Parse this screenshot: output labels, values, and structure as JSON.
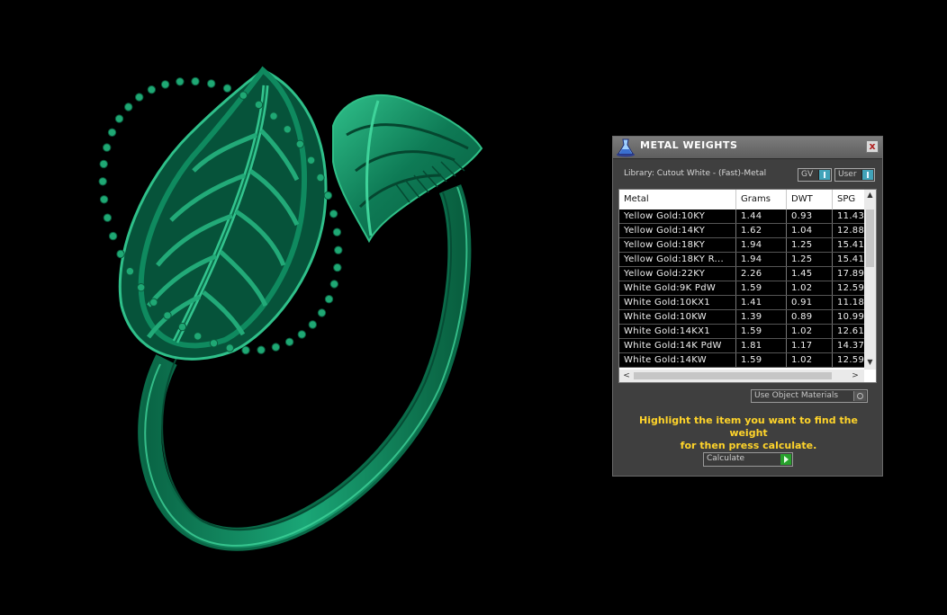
{
  "panel": {
    "title": "METAL WEIGHTS",
    "title_icon": "flask-icon",
    "close_label": "x",
    "library_label": "Library: Cutout White - (Fast)-Metal",
    "gv_label": "GV",
    "user_label": "User",
    "table": {
      "columns": [
        "Metal",
        "Grams",
        "DWT",
        "SPG"
      ],
      "rows": [
        [
          "Yellow Gold:10KY",
          "1.44",
          "0.93",
          "11.43"
        ],
        [
          "Yellow Gold:14KY",
          "1.62",
          "1.04",
          "12.88"
        ],
        [
          "Yellow Gold:18KY",
          "1.94",
          "1.25",
          "15.41"
        ],
        [
          "Yellow Gold:18KY R...",
          "1.94",
          "1.25",
          "15.41"
        ],
        [
          "Yellow Gold:22KY",
          "2.26",
          "1.45",
          "17.89"
        ],
        [
          "White Gold:9K PdW",
          "1.59",
          "1.02",
          "12.59"
        ],
        [
          "White Gold:10KX1",
          "1.41",
          "0.91",
          "11.18"
        ],
        [
          "White Gold:10KW",
          "1.39",
          "0.89",
          "10.99"
        ],
        [
          "White Gold:14KX1",
          "1.59",
          "1.02",
          "12.61"
        ],
        [
          "White Gold:14K PdW",
          "1.81",
          "1.17",
          "14.37"
        ],
        [
          "White Gold:14KW",
          "1.59",
          "1.02",
          "12.59"
        ]
      ]
    },
    "use_object_materials_label": "Use Object Materials",
    "hint_line1": "Highlight the item you want to find the weight",
    "hint_line2": "for then press calculate.",
    "calculate_label": "Calculate"
  },
  "colors": {
    "ring": "#0f8a5f",
    "ring_highlight": "#3fd39a",
    "hint": "#ffd42a",
    "toggle_active": "#41a3b9",
    "calculate_go": "#27a12c"
  }
}
